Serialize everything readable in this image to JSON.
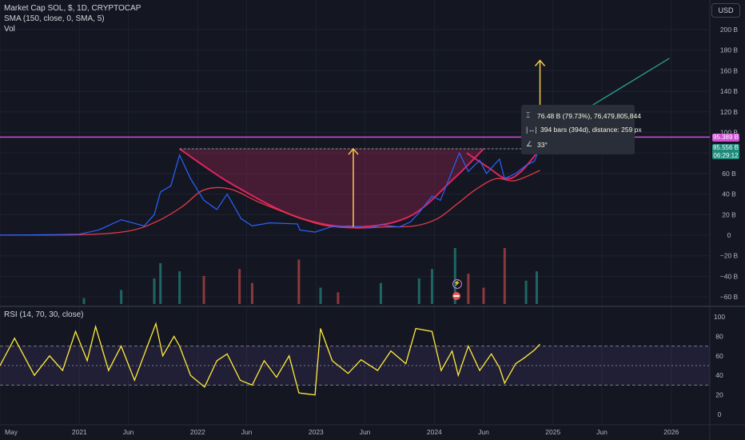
{
  "legend": {
    "symbol_line": "Market Cap SOL, $, 1D, CRYPTOCAP",
    "sma_line": "SMA (150, close, 0, SMA, 5)",
    "vol_line": "Vol",
    "rsi_line": "RSI (14, 70, 30, close)"
  },
  "currency_button": "USD",
  "measure_tooltip": {
    "price_change": "76.48 B (79.73%), 76,479,805,844",
    "bars_distance": "394 bars (394d), distance: 259 px",
    "angle": "33°",
    "price_icon": "price-range-icon",
    "bars_icon": "date-range-icon",
    "angle_icon": "angle-icon"
  },
  "price_tags": {
    "level_label": "95.389 B",
    "current_label": "85.556 B",
    "countdown": "06:29:12"
  },
  "colors": {
    "background": "#141722",
    "price_line": "#2962ff",
    "sma_line": "#e63946",
    "level_line": "#d14fd6",
    "cup_fill": "#b2245a",
    "arrow": "#f7c948",
    "trend_line": "#2a9d8f",
    "rsi_line": "#ffeb3b",
    "rsi_band": "#7e57c2",
    "vol_up": "#26a69a",
    "vol_down": "#ef5350"
  },
  "chart_data": [
    {
      "type": "line",
      "title": "Market Cap SOL, $, 1D, CRYPTOCAP",
      "ylabel": "USD",
      "y_unit": "B",
      "ylim": [
        -70,
        210
      ],
      "x_range": [
        "2020-05-01",
        "2026-04-30"
      ],
      "y_ticks": [
        200,
        180,
        160,
        140,
        120,
        100,
        80,
        60,
        40,
        20,
        0,
        -20,
        -40,
        -60
      ],
      "y_tick_labels": [
        "200 B",
        "180 B",
        "160 B",
        "140 B",
        "120 B",
        "100 B",
        "80 B",
        "60 B",
        "40 B",
        "20 B",
        "0",
        "−20 B",
        "−40 B",
        "−60 B"
      ],
      "x_ticks": [
        "2020-05-01",
        "2021-01-01",
        "2021-06-01",
        "2022-01-01",
        "2022-06-01",
        "2023-01-01",
        "2023-06-01",
        "2024-01-01",
        "2024-06-01",
        "2025-01-01",
        "2025-06-01",
        "2026-01-01"
      ],
      "x_tick_labels": [
        "May",
        "2021",
        "Jun",
        "2022",
        "Jun",
        "2023",
        "Jun",
        "2024",
        "Jun",
        "2025",
        "Jun",
        "2026"
      ],
      "series": [
        {
          "role": "price",
          "x": [
            "2020-05-01",
            "2020-08-01",
            "2020-11-01",
            "2021-01-01",
            "2021-03-01",
            "2021-05-10",
            "2021-07-20",
            "2021-08-20",
            "2021-09-08",
            "2021-10-10",
            "2021-11-06",
            "2021-12-10",
            "2022-01-20",
            "2022-03-01",
            "2022-04-02",
            "2022-05-15",
            "2022-06-18",
            "2022-08-10",
            "2022-11-05",
            "2022-11-12",
            "2022-12-29",
            "2023-02-15",
            "2023-04-15",
            "2023-06-15",
            "2023-07-20",
            "2023-09-15",
            "2023-10-20",
            "2023-11-15",
            "2023-12-25",
            "2024-01-20",
            "2024-03-18",
            "2024-04-15",
            "2024-05-20",
            "2024-06-10",
            "2024-07-20",
            "2024-08-05",
            "2024-09-08",
            "2024-10-10",
            "2024-11-05",
            "2024-11-22"
          ],
          "values": [
            0.1,
            0.3,
            0.6,
            1.0,
            5,
            15,
            9,
            20,
            42,
            48,
            78,
            55,
            34,
            25,
            40,
            16,
            9,
            12,
            11,
            5,
            3,
            8,
            9,
            7,
            10,
            8,
            13,
            22,
            38,
            34,
            80,
            62,
            73,
            60,
            74,
            55,
            60,
            68,
            72,
            85.6
          ]
        },
        {
          "role": "sma",
          "name": "SMA (150, close, 0, SMA, 5)",
          "x": [
            "2020-05-01",
            "2021-01-01",
            "2021-06-01",
            "2021-09-01",
            "2021-11-15",
            "2022-01-20",
            "2022-04-10",
            "2022-07-10",
            "2022-10-15",
            "2023-01-20",
            "2023-05-01",
            "2023-08-01",
            "2023-11-01",
            "2024-01-10",
            "2024-03-10",
            "2024-05-10",
            "2024-07-10",
            "2024-09-05",
            "2024-11-22"
          ],
          "values": [
            0.1,
            0.5,
            4,
            14,
            28,
            44,
            45,
            32,
            20,
            10,
            7,
            8,
            9,
            16,
            30,
            45,
            55,
            53,
            63
          ]
        },
        {
          "role": "level_line",
          "name": "horizontal level",
          "value": 95.389
        },
        {
          "role": "cup_rim",
          "value": 84,
          "x": [
            "2021-11-06",
            "2024-11-22"
          ]
        },
        {
          "role": "cup_arc",
          "x": [
            "2021-11-06",
            "2022-04-15",
            "2022-11-01",
            "2023-04-26",
            "2023-10-15",
            "2024-03-01",
            "2024-06-01"
          ],
          "values": [
            84,
            50,
            18,
            8,
            18,
            55,
            84
          ]
        },
        {
          "role": "handle_arc",
          "x": [
            "2024-04-10",
            "2024-06-15",
            "2024-08-10",
            "2024-09-25",
            "2024-11-22"
          ],
          "values": [
            80,
            66,
            55,
            62,
            84
          ]
        },
        {
          "role": "measure_arrow",
          "x": [
            "2023-04-26",
            "2023-04-26"
          ],
          "values": [
            8,
            84
          ]
        },
        {
          "role": "measure_arrow",
          "x": [
            "2024-11-22",
            "2024-11-22"
          ],
          "values": [
            95.4,
            170
          ]
        },
        {
          "role": "trend_line",
          "x": [
            "2024-11-22",
            "2025-12-26"
          ],
          "values": [
            95.4,
            172
          ]
        }
      ]
    },
    {
      "type": "bar",
      "title": "Vol",
      "x_range": [
        "2020-05-01",
        "2026-04-30"
      ],
      "x": [
        "2021-01-15",
        "2021-05-10",
        "2021-08-20",
        "2021-09-08",
        "2021-11-06",
        "2022-01-20",
        "2022-05-10",
        "2022-06-18",
        "2022-11-09",
        "2023-01-15",
        "2023-03-10",
        "2023-07-20",
        "2023-11-15",
        "2023-12-25",
        "2024-03-05",
        "2024-04-15",
        "2024-06-01",
        "2024-08-05",
        "2024-10-10",
        "2024-11-12"
      ],
      "values": [
        5,
        12,
        22,
        35,
        28,
        24,
        30,
        18,
        38,
        14,
        10,
        18,
        22,
        30,
        48,
        26,
        14,
        48,
        20,
        28
      ],
      "direction": [
        "up",
        "up",
        "up",
        "up",
        "up",
        "down",
        "down",
        "down",
        "down",
        "up",
        "down",
        "up",
        "up",
        "up",
        "up",
        "down",
        "down",
        "down",
        "up",
        "up"
      ],
      "relative": true
    },
    {
      "type": "line",
      "title": "RSI (14, 70, 30, close)",
      "ylim": [
        0,
        100
      ],
      "y_ticks": [
        100,
        80,
        60,
        40,
        20,
        0
      ],
      "bands": {
        "upper": 70,
        "middle": 50,
        "lower": 30
      },
      "x": [
        "2020-05-01",
        "2020-06-15",
        "2020-08-15",
        "2020-10-01",
        "2020-11-10",
        "2020-12-20",
        "2021-01-25",
        "2021-02-20",
        "2021-04-01",
        "2021-05-10",
        "2021-06-20",
        "2021-08-25",
        "2021-09-15",
        "2021-10-20",
        "2021-11-06",
        "2021-12-10",
        "2022-01-22",
        "2022-03-01",
        "2022-04-02",
        "2022-05-12",
        "2022-06-18",
        "2022-07-25",
        "2022-09-01",
        "2022-10-10",
        "2022-11-09",
        "2022-12-29",
        "2023-01-15",
        "2023-02-20",
        "2023-04-10",
        "2023-05-20",
        "2023-07-10",
        "2023-08-20",
        "2023-10-05",
        "2023-11-05",
        "2023-12-25",
        "2024-01-22",
        "2024-02-25",
        "2024-03-15",
        "2024-04-15",
        "2024-05-20",
        "2024-06-25",
        "2024-07-20",
        "2024-08-05",
        "2024-09-08",
        "2024-10-05",
        "2024-11-05",
        "2024-11-22"
      ],
      "values": [
        50,
        78,
        40,
        60,
        45,
        85,
        55,
        90,
        45,
        70,
        35,
        93,
        60,
        80,
        70,
        40,
        28,
        55,
        62,
        35,
        30,
        55,
        38,
        60,
        22,
        20,
        88,
        55,
        42,
        56,
        45,
        65,
        52,
        88,
        85,
        45,
        65,
        40,
        70,
        45,
        62,
        48,
        32,
        52,
        58,
        66,
        72
      ]
    }
  ]
}
